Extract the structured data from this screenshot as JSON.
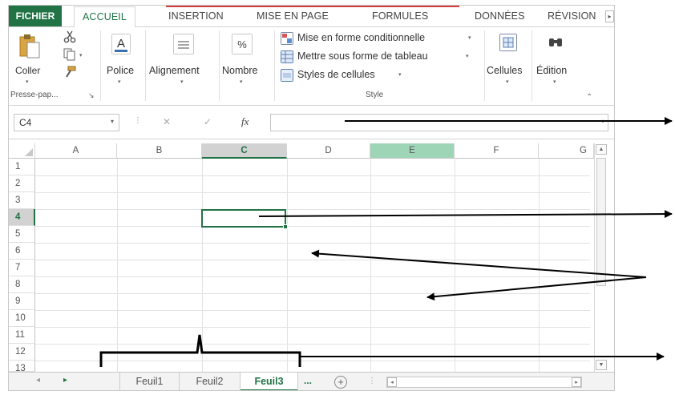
{
  "ribbon_tabs": [
    {
      "label": "FICHIER"
    },
    {
      "label": "ACCUEIL"
    },
    {
      "label": "INSERTION"
    },
    {
      "label": "MISE EN PAGE"
    },
    {
      "label": "FORMULES"
    },
    {
      "label": "DONNÉES"
    },
    {
      "label": "RÉVISION"
    }
  ],
  "ribbon": {
    "clipboard": {
      "paste_label": "Coller",
      "group_label": "Presse-pap..."
    },
    "font": {
      "label": "Police"
    },
    "alignment": {
      "label": "Alignement"
    },
    "number": {
      "label": "Nombre"
    },
    "styles": {
      "conditional_label": "Mise en forme conditionnelle",
      "table_label": "Mettre sous forme de tableau",
      "cell_styles_label": "Styles de cellules",
      "group_label": "Style"
    },
    "cells": {
      "label": "Cellules"
    },
    "editing": {
      "label": "Édition"
    }
  },
  "formula_bar": {
    "name_box": "C4",
    "cancel_symbol": "✕",
    "enter_symbol": "✓",
    "fx_label": "fx",
    "formula_value": ""
  },
  "grid": {
    "columns": [
      "A",
      "B",
      "C",
      "D",
      "E",
      "F",
      "G"
    ],
    "rows": [
      "1",
      "2",
      "3",
      "4",
      "5",
      "6",
      "7",
      "8",
      "9",
      "10",
      "11",
      "12",
      "13"
    ],
    "selected_cell": "C4"
  },
  "sheets": {
    "tabs": [
      "Feuil1",
      "Feuil2",
      "Feuil3"
    ],
    "active": "Feuil3",
    "more_label": "...",
    "add_label": "+"
  },
  "colors": {
    "excel_green": "#217346",
    "highlight_column": "#9fd5b7",
    "tab_accent_line": "#d04040"
  }
}
